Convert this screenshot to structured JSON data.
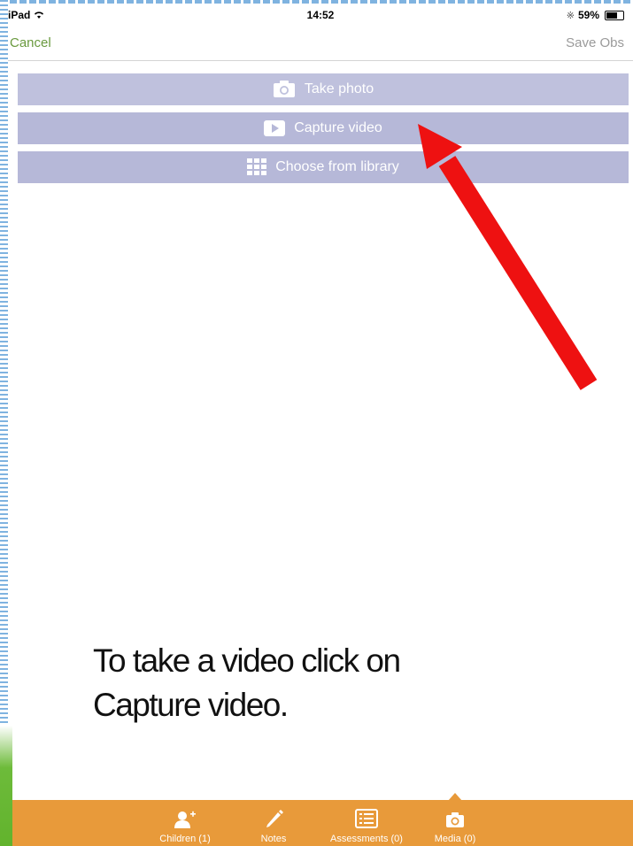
{
  "status_bar": {
    "device": "iPad",
    "time": "14:52",
    "battery": "59%",
    "battery_level": 0.59
  },
  "nav_bar": {
    "cancel_label": "Cancel",
    "save_label": "Save Obs"
  },
  "actions": {
    "take_photo": "Take photo",
    "capture_video": "Capture video",
    "choose_library": "Choose from library"
  },
  "caption": {
    "line1": "To take a video click on",
    "line2": "Capture video."
  },
  "tabs": {
    "children": "Children (1)",
    "notes": "Notes",
    "assessments": "Assessments (0)",
    "media": "Media (0)"
  },
  "colors": {
    "accent_green": "#6a9a3f",
    "action_button": "#b6b8d8",
    "tab_bar": "#e89a3a",
    "arrow": "#ee1111"
  },
  "icons": {
    "take_photo": "camera-icon",
    "capture_video": "play-icon",
    "choose_library": "grid-icon",
    "children": "add-person-icon",
    "notes": "pencil-icon",
    "assessments": "list-icon",
    "media": "camera-icon"
  }
}
